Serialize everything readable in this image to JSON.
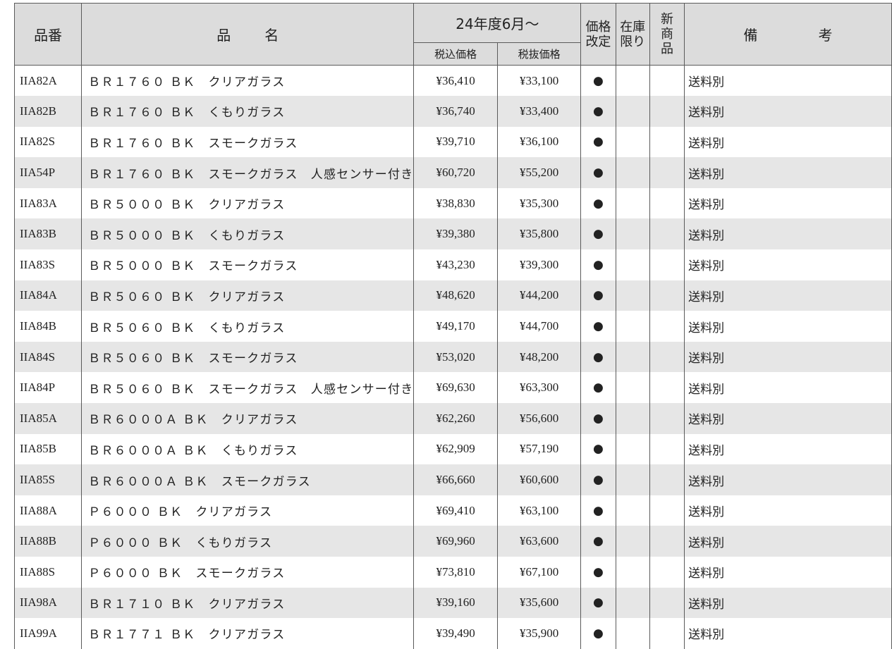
{
  "header": {
    "code": "品番",
    "name_a": "品",
    "name_b": "名",
    "period": "24年度6月～",
    "tax_in": "税込価格",
    "tax_ex": "税抜価格",
    "revised": [
      "価格",
      "改定"
    ],
    "limited": [
      "在庫",
      "限り"
    ],
    "new": [
      "新",
      "商",
      "品"
    ],
    "remarks_a": "備",
    "remarks_b": "考"
  },
  "rows": [
    {
      "code": "IIA82A",
      "name": "ＢＲ１７６０ ＢＫ　クリアガラス",
      "tax_in": "¥36,410",
      "tax_ex": "¥33,100",
      "revised": "●",
      "limited": "",
      "new": "",
      "remarks": "送料別"
    },
    {
      "code": "IIA82B",
      "name": "ＢＲ１７６０ ＢＫ　くもりガラス",
      "tax_in": "¥36,740",
      "tax_ex": "¥33,400",
      "revised": "●",
      "limited": "",
      "new": "",
      "remarks": "送料別"
    },
    {
      "code": "IIA82S",
      "name": "ＢＲ１７６０ ＢＫ　スモークガラス",
      "tax_in": "¥39,710",
      "tax_ex": "¥36,100",
      "revised": "●",
      "limited": "",
      "new": "",
      "remarks": "送料別"
    },
    {
      "code": "IIA54P",
      "name": "ＢＲ１７６０ ＢＫ　スモークガラス　人感センサー付き",
      "tax_in": "¥60,720",
      "tax_ex": "¥55,200",
      "revised": "●",
      "limited": "",
      "new": "",
      "remarks": "送料別"
    },
    {
      "code": "IIA83A",
      "name": "ＢＲ５０００ ＢＫ　クリアガラス",
      "tax_in": "¥38,830",
      "tax_ex": "¥35,300",
      "revised": "●",
      "limited": "",
      "new": "",
      "remarks": "送料別"
    },
    {
      "code": "IIA83B",
      "name": "ＢＲ５０００ ＢＫ　くもりガラス",
      "tax_in": "¥39,380",
      "tax_ex": "¥35,800",
      "revised": "●",
      "limited": "",
      "new": "",
      "remarks": "送料別"
    },
    {
      "code": "IIA83S",
      "name": "ＢＲ５０００ ＢＫ　スモークガラス",
      "tax_in": "¥43,230",
      "tax_ex": "¥39,300",
      "revised": "●",
      "limited": "",
      "new": "",
      "remarks": "送料別"
    },
    {
      "code": "IIA84A",
      "name": "ＢＲ５０６０ ＢＫ　クリアガラス",
      "tax_in": "¥48,620",
      "tax_ex": "¥44,200",
      "revised": "●",
      "limited": "",
      "new": "",
      "remarks": "送料別"
    },
    {
      "code": "IIA84B",
      "name": "ＢＲ５０６０ ＢＫ　くもりガラス",
      "tax_in": "¥49,170",
      "tax_ex": "¥44,700",
      "revised": "●",
      "limited": "",
      "new": "",
      "remarks": "送料別"
    },
    {
      "code": "IIA84S",
      "name": "ＢＲ５０６０ ＢＫ　スモークガラス",
      "tax_in": "¥53,020",
      "tax_ex": "¥48,200",
      "revised": "●",
      "limited": "",
      "new": "",
      "remarks": "送料別"
    },
    {
      "code": "IIA84P",
      "name": "ＢＲ５０６０ ＢＫ　スモークガラス　人感センサー付き",
      "tax_in": "¥69,630",
      "tax_ex": "¥63,300",
      "revised": "●",
      "limited": "",
      "new": "",
      "remarks": "送料別"
    },
    {
      "code": "IIA85A",
      "name": "ＢＲ６０００Ａ ＢＫ　クリアガラス",
      "tax_in": "¥62,260",
      "tax_ex": "¥56,600",
      "revised": "●",
      "limited": "",
      "new": "",
      "remarks": "送料別"
    },
    {
      "code": "IIA85B",
      "name": "ＢＲ６０００Ａ ＢＫ　くもりガラス",
      "tax_in": "¥62,909",
      "tax_ex": "¥57,190",
      "revised": "●",
      "limited": "",
      "new": "",
      "remarks": "送料別"
    },
    {
      "code": "IIA85S",
      "name": "ＢＲ６０００Ａ ＢＫ　スモークガラス",
      "tax_in": "¥66,660",
      "tax_ex": "¥60,600",
      "revised": "●",
      "limited": "",
      "new": "",
      "remarks": "送料別"
    },
    {
      "code": "IIA88A",
      "name": "Ｐ６０００ ＢＫ　クリアガラス",
      "tax_in": "¥69,410",
      "tax_ex": "¥63,100",
      "revised": "●",
      "limited": "",
      "new": "",
      "remarks": "送料別"
    },
    {
      "code": "IIA88B",
      "name": "Ｐ６０００ ＢＫ　くもりガラス",
      "tax_in": "¥69,960",
      "tax_ex": "¥63,600",
      "revised": "●",
      "limited": "",
      "new": "",
      "remarks": "送料別"
    },
    {
      "code": "IIA88S",
      "name": "Ｐ６０００ ＢＫ　スモークガラス",
      "tax_in": "¥73,810",
      "tax_ex": "¥67,100",
      "revised": "●",
      "limited": "",
      "new": "",
      "remarks": "送料別"
    },
    {
      "code": "IIA98A",
      "name": "ＢＲ１７１０ ＢＫ　クリアガラス",
      "tax_in": "¥39,160",
      "tax_ex": "¥35,600",
      "revised": "●",
      "limited": "",
      "new": "",
      "remarks": "送料別"
    },
    {
      "code": "IIA99A",
      "name": "ＢＲ１７７１ ＢＫ　クリアガラス",
      "tax_in": "¥39,490",
      "tax_ex": "¥35,900",
      "revised": "●",
      "limited": "",
      "new": "",
      "remarks": "送料別"
    }
  ]
}
